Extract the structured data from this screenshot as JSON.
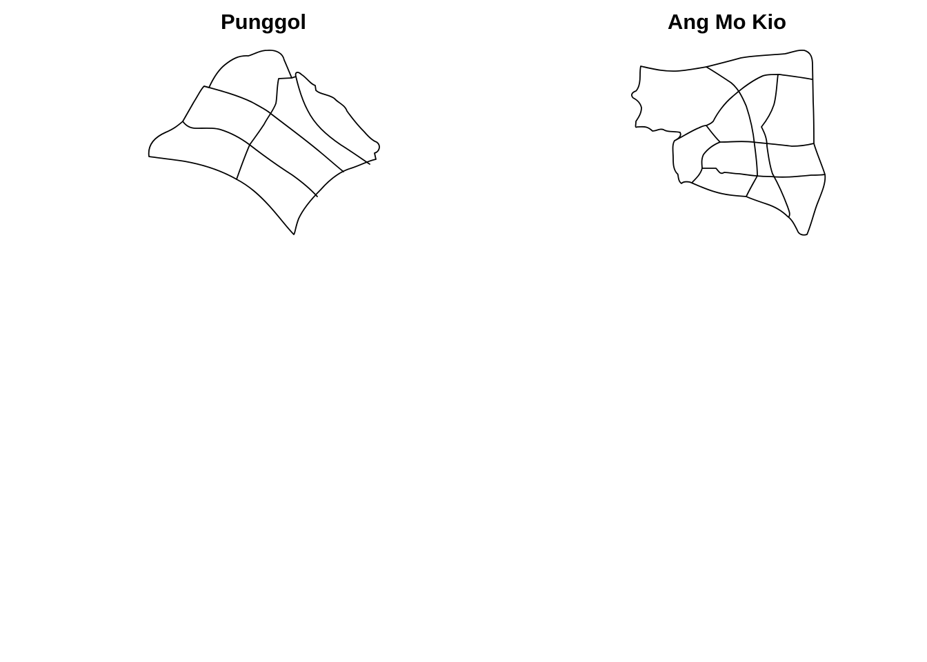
{
  "maps": [
    {
      "id": "punggol",
      "title": "Punggol",
      "line_color": "#000000",
      "fill_color": "#ffffff",
      "subzone_count": 7
    },
    {
      "id": "ang-mo-kio",
      "title": "Ang Mo Kio",
      "line_color": "#000000",
      "fill_color": "#ffffff",
      "subzone_count": 12
    }
  ],
  "background_color": "#ffffff"
}
